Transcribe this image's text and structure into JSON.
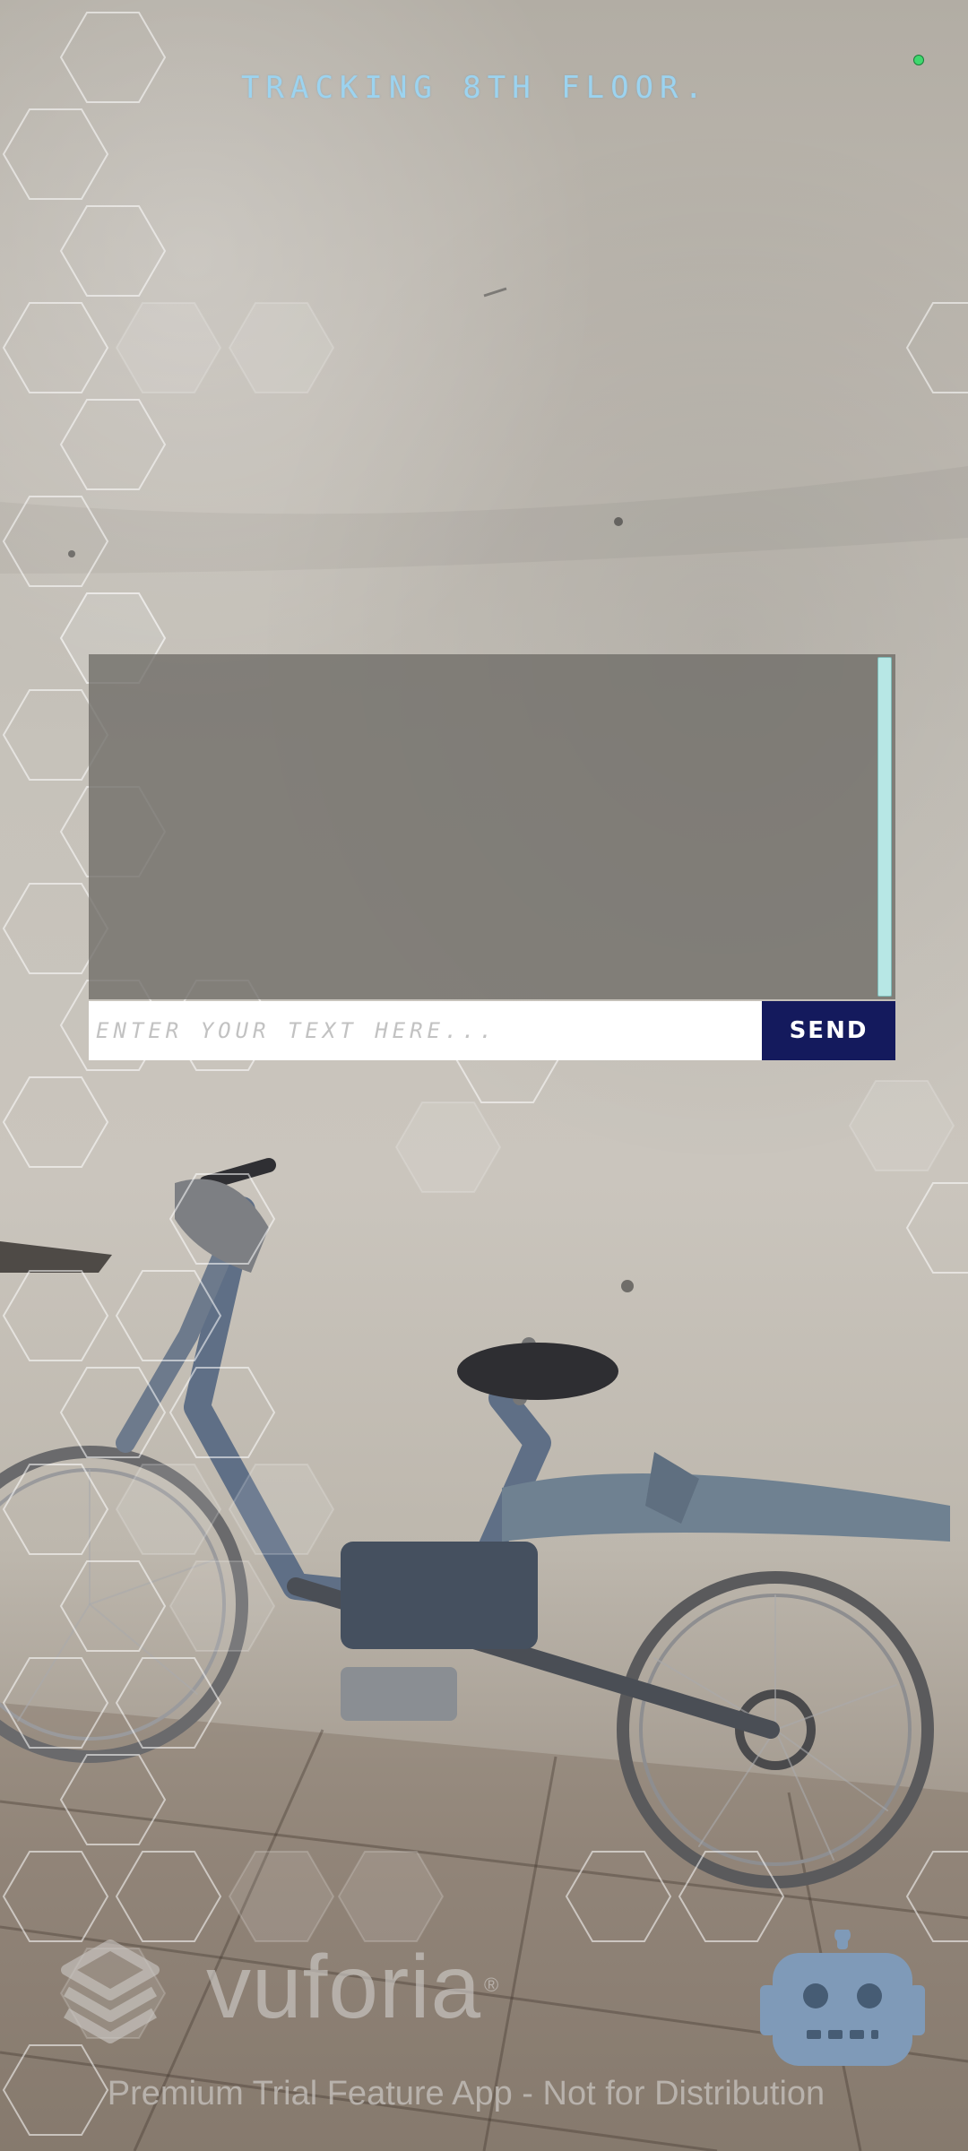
{
  "status": {
    "tracking_text": "TRACKING 8TH FLOOR.",
    "indicator_color": "#3fd86e"
  },
  "chat": {
    "messages": [],
    "input_placeholder": "ENTER YOUR TEXT HERE...",
    "input_value": "",
    "send_label": "SEND",
    "scrollbar_color": "#b7e7e5",
    "send_color": "#141a5d"
  },
  "watermark": {
    "wordmark": "vuforia",
    "registered_mark": "®",
    "notice": "Premium Trial Feature App - Not for Distribution"
  },
  "icons": {
    "brand": "vuforia-logo-icon",
    "assistant": "robot-icon",
    "overlay": "hexagon-grid"
  }
}
